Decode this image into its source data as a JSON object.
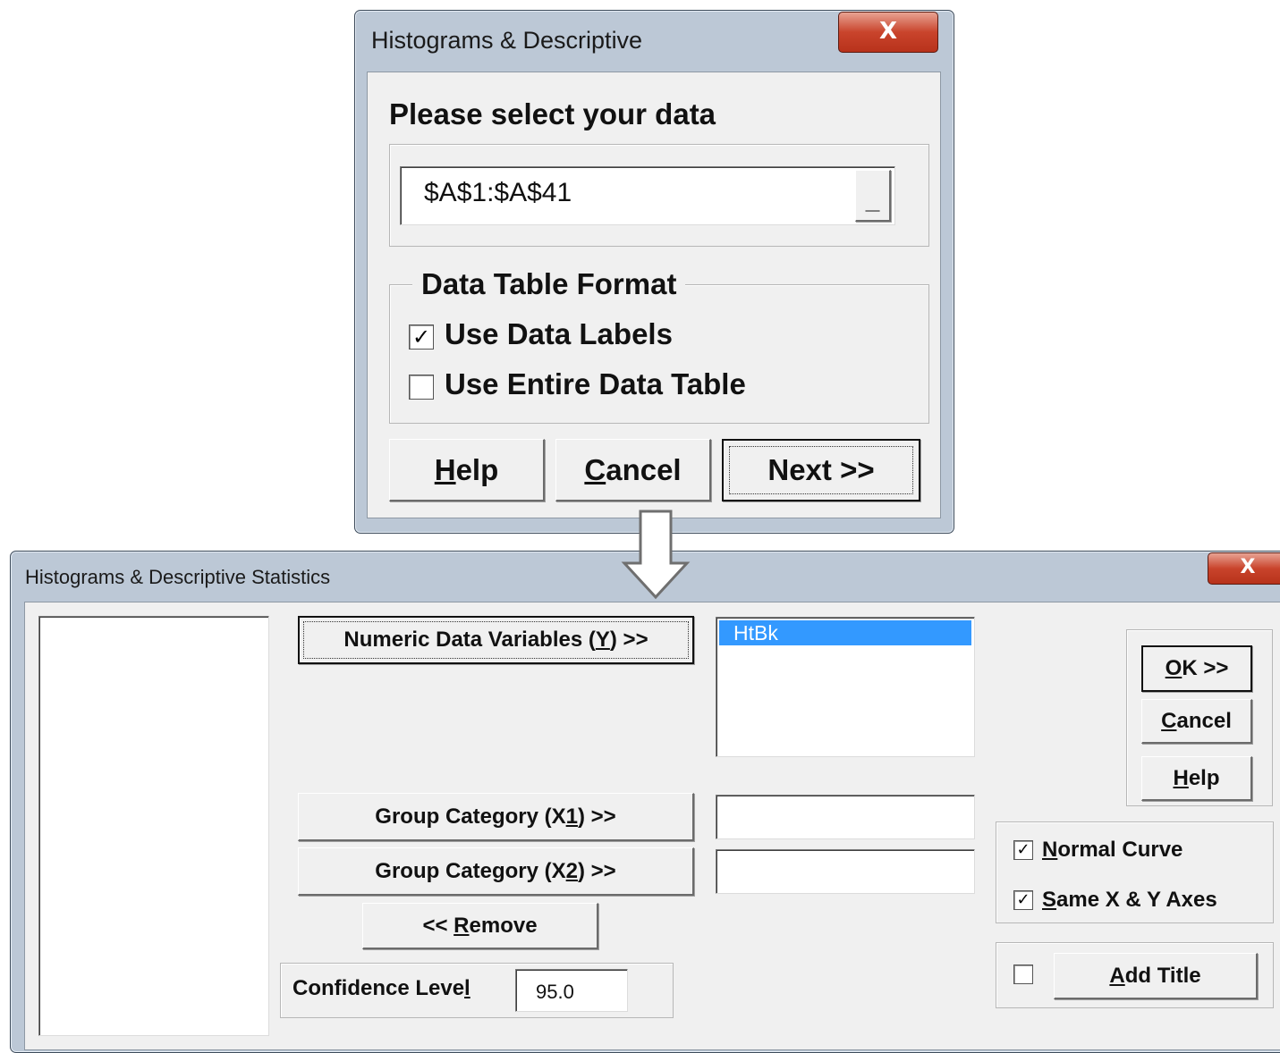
{
  "dialog1": {
    "title": "Histograms & Descriptive",
    "close_glyph": "X",
    "prompt": "Please select your data",
    "range_value": "$A$1:$A$41",
    "range_button_glyph": "_",
    "group_title": "Data Table Format",
    "use_data_labels": {
      "label": "Use Data Labels",
      "checked": true,
      "mark": "✓"
    },
    "use_entire_table": {
      "label": "Use Entire Data Table",
      "checked": false,
      "mark": ""
    },
    "help_label_pre": "",
    "help_label_u": "H",
    "help_label_post": "elp",
    "cancel_label_pre": "",
    "cancel_label_u": "C",
    "cancel_label_post": "ancel",
    "next_label": "Next >>"
  },
  "arrow_icon": "down-arrow",
  "dialog2": {
    "title": "Histograms & Descriptive Statistics",
    "close_glyph": "X",
    "numeric_btn_pre": "Numeric Data Variables (",
    "numeric_btn_u": "Y",
    "numeric_btn_post": ") >>",
    "selected_variables": [
      "HtBk"
    ],
    "group1_btn_pre": "Group Category (X",
    "group1_btn_u": "1",
    "group1_btn_post": ") >>",
    "group2_btn_pre": "Group Category (X",
    "group2_btn_u": "2",
    "group2_btn_post": ") >>",
    "remove_pre": "<< ",
    "remove_u": "R",
    "remove_post": "emove",
    "confidence_pre": "Confidence Leve",
    "confidence_u": "l",
    "confidence_value": "95.0",
    "ok_u": "O",
    "ok_post": "K >>",
    "cancel_u": "C",
    "cancel_post": "ancel",
    "help_u": "H",
    "help_post": "elp",
    "normal_curve": {
      "u": "N",
      "post": "ormal Curve",
      "checked": true,
      "mark": "✓"
    },
    "same_axes": {
      "u": "S",
      "post": "ame X & Y Axes",
      "checked": true,
      "mark": "✓"
    },
    "add_title_check": {
      "checked": false,
      "mark": ""
    },
    "add_title_u": "A",
    "add_title_post": "dd Title"
  },
  "colors": {
    "selection": "#3399ff",
    "close_red": "#c9442c",
    "chrome": "#bcc8d6"
  }
}
